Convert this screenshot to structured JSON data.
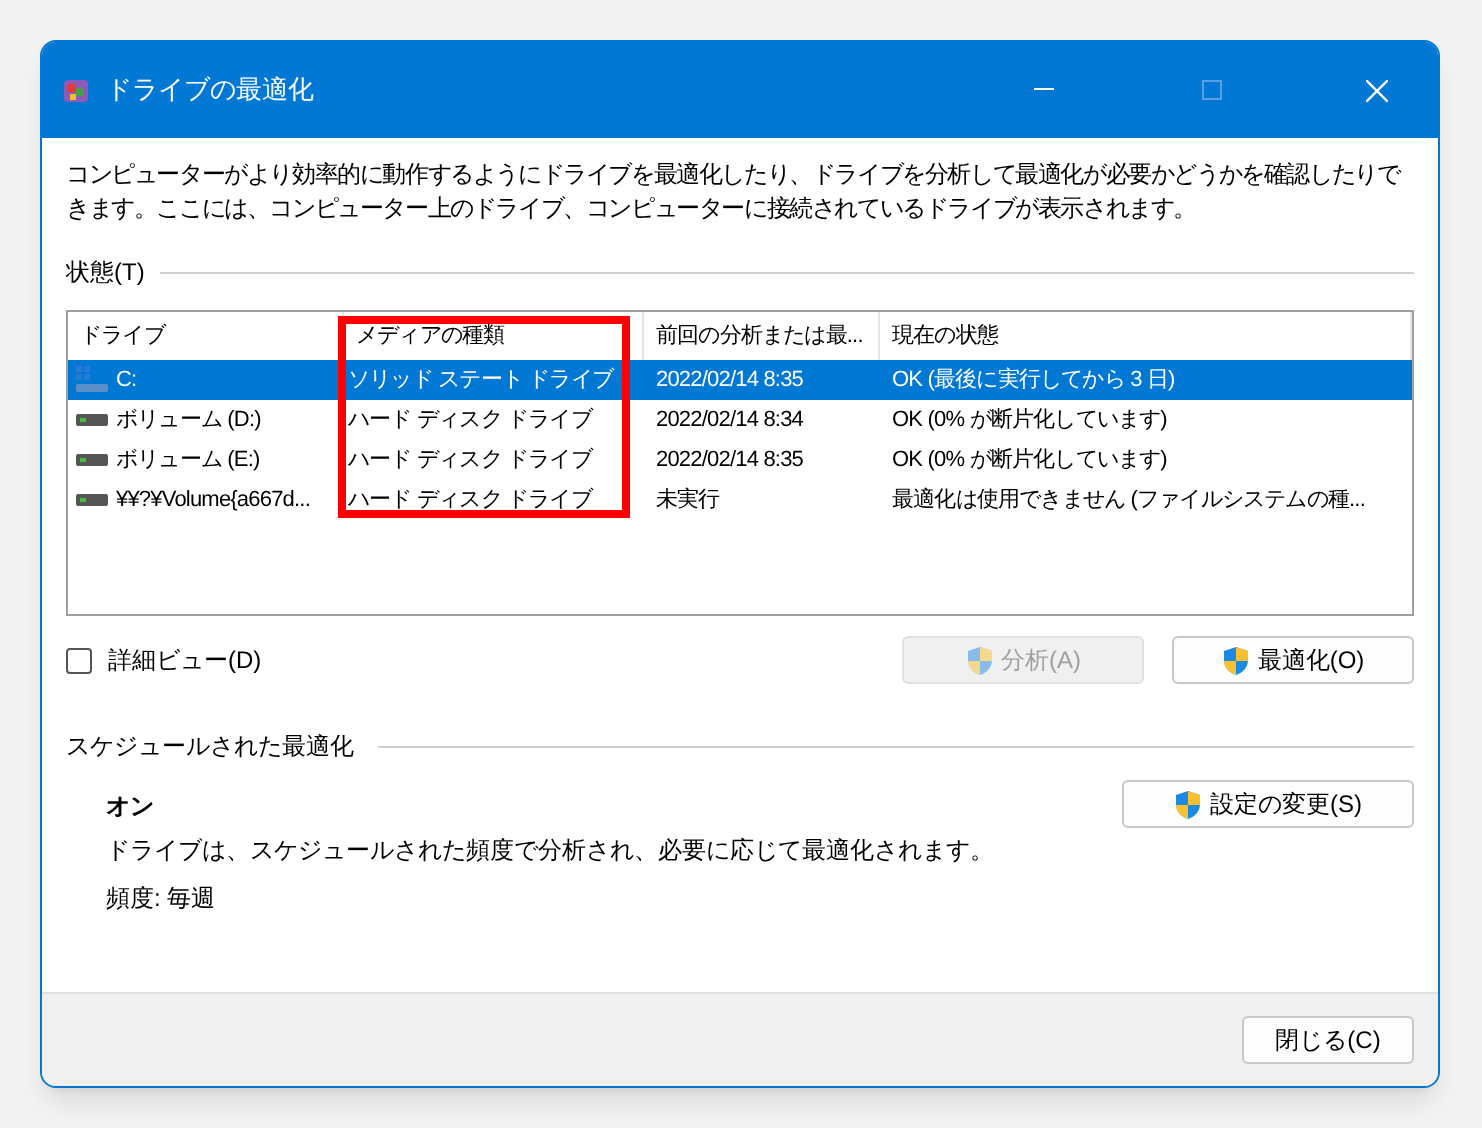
{
  "window": {
    "title": "ドライブの最適化"
  },
  "description": "コンピューターがより効率的に動作するようにドライブを最適化したり、ドライブを分析して最適化が必要かどうかを確認したりできます。ここには、コンピューター上のドライブ、コンピューターに接続されているドライブが表示されます。",
  "status_section": {
    "title": "状態(T)"
  },
  "table": {
    "columns": [
      "ドライブ",
      "メディアの種類",
      "前回の分析または最...",
      "現在の状態"
    ],
    "rows": [
      {
        "kind": "ssd",
        "selected": true,
        "cells": [
          "C:",
          "ソリッド ステート ドライブ",
          "2022/02/14 8:35",
          "OK (最後に実行してから 3 日)"
        ]
      },
      {
        "kind": "hdd",
        "selected": false,
        "cells": [
          "ボリューム (D:)",
          "ハード ディスク ドライブ",
          "2022/02/14 8:34",
          "OK (0% が断片化しています)"
        ]
      },
      {
        "kind": "hdd",
        "selected": false,
        "cells": [
          "ボリューム (E:)",
          "ハード ディスク ドライブ",
          "2022/02/14 8:35",
          "OK (0% が断片化しています)"
        ]
      },
      {
        "kind": "hdd",
        "selected": false,
        "cells": [
          "¥¥?¥Volume{a667d...",
          "ハード ディスク ドライブ",
          "未実行",
          "最適化は使用できません (ファイルシステムの種..."
        ]
      }
    ]
  },
  "detail_view": {
    "label": "詳細ビュー(D)",
    "checked": false
  },
  "buttons": [
    {
      "label": "分析(A)",
      "disabled": true
    },
    {
      "label": "最適化(O)",
      "disabled": false
    }
  ],
  "schedule": {
    "title": "スケジュールされた最適化",
    "state": "オン",
    "text": "ドライブは、スケジュールされた頻度で分析され、必要に応じて最適化されます。",
    "frequency": "頻度: 毎週",
    "button": "設定の変更(S)"
  },
  "close_button": "閉じる(C)"
}
